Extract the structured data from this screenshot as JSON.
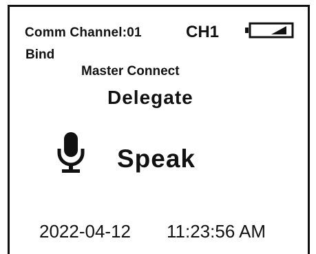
{
  "status_bar": {
    "comm_channel": "Comm Channel:01",
    "channel": "CH1",
    "battery_icon": "battery-icon"
  },
  "mode": {
    "bind": "Bind",
    "master_connect": "Master Connect",
    "role": "Delegate"
  },
  "mic": {
    "icon": "microphone-icon",
    "label": "Speak"
  },
  "clock": {
    "date": "2022-04-12",
    "time": "11:23:56 AM"
  }
}
